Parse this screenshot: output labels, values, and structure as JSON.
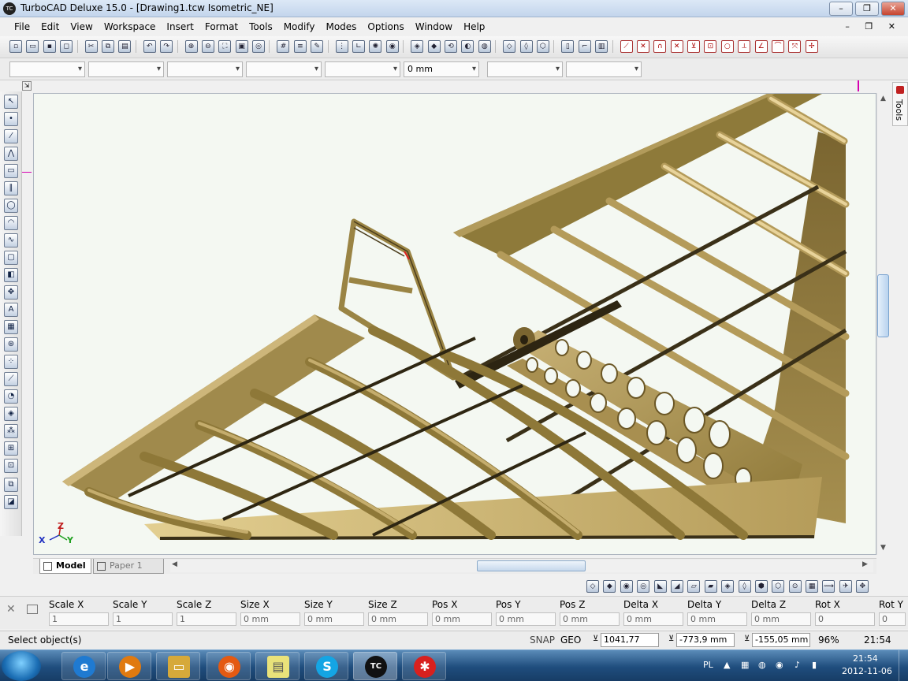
{
  "window": {
    "title": "TurboCAD Deluxe 15.0 - [Drawing1.tcw Isometric_NE]",
    "icon_text": "TC",
    "minimize": "–",
    "maximize": "❐",
    "close": "✕"
  },
  "menu": {
    "items": [
      "File",
      "Edit",
      "View",
      "Workspace",
      "Insert",
      "Format",
      "Tools",
      "Modify",
      "Modes",
      "Options",
      "Window",
      "Help"
    ]
  },
  "mdi": {
    "label": "– ❐ ✕"
  },
  "property_bar": {
    "field6_value": "0 mm"
  },
  "right_panel": {
    "tab_label": "Tools"
  },
  "tabs": {
    "model": "Model",
    "paper": "Paper 1"
  },
  "coordinate_fields": [
    {
      "label": "Scale X",
      "value": "1"
    },
    {
      "label": "Scale Y",
      "value": "1"
    },
    {
      "label": "Scale Z",
      "value": "1"
    },
    {
      "label": "Size X",
      "value": "0 mm"
    },
    {
      "label": "Size Y",
      "value": "0 mm"
    },
    {
      "label": "Size Z",
      "value": "0 mm"
    },
    {
      "label": "Pos X",
      "value": "0 mm"
    },
    {
      "label": "Pos Y",
      "value": "0 mm"
    },
    {
      "label": "Pos Z",
      "value": "0 mm"
    },
    {
      "label": "Delta X",
      "value": "0 mm"
    },
    {
      "label": "Delta Y",
      "value": "0 mm"
    },
    {
      "label": "Delta Z",
      "value": "0 mm"
    },
    {
      "label": "Rot X",
      "value": "0"
    },
    {
      "label": "Rot Y",
      "value": "0"
    }
  ],
  "status": {
    "prompt": "Select object(s)",
    "snap": "SNAP",
    "geo": "GEO",
    "x": "1041,77 mm",
    "y": "-773,9 mm",
    "z": "-155,05 mm",
    "zoom": "96%",
    "time": "21:54"
  },
  "axis": {
    "x": "X",
    "y": "Y",
    "z": "Z"
  },
  "taskbar": {
    "lang": "PL",
    "time": "21:54",
    "date": "2012-11-06"
  },
  "colors": {
    "wood": "#a08a4c",
    "wood_light": "#d6bf7f",
    "wood_dark": "#6e5a2a",
    "canvas": "#f4f8f2"
  }
}
